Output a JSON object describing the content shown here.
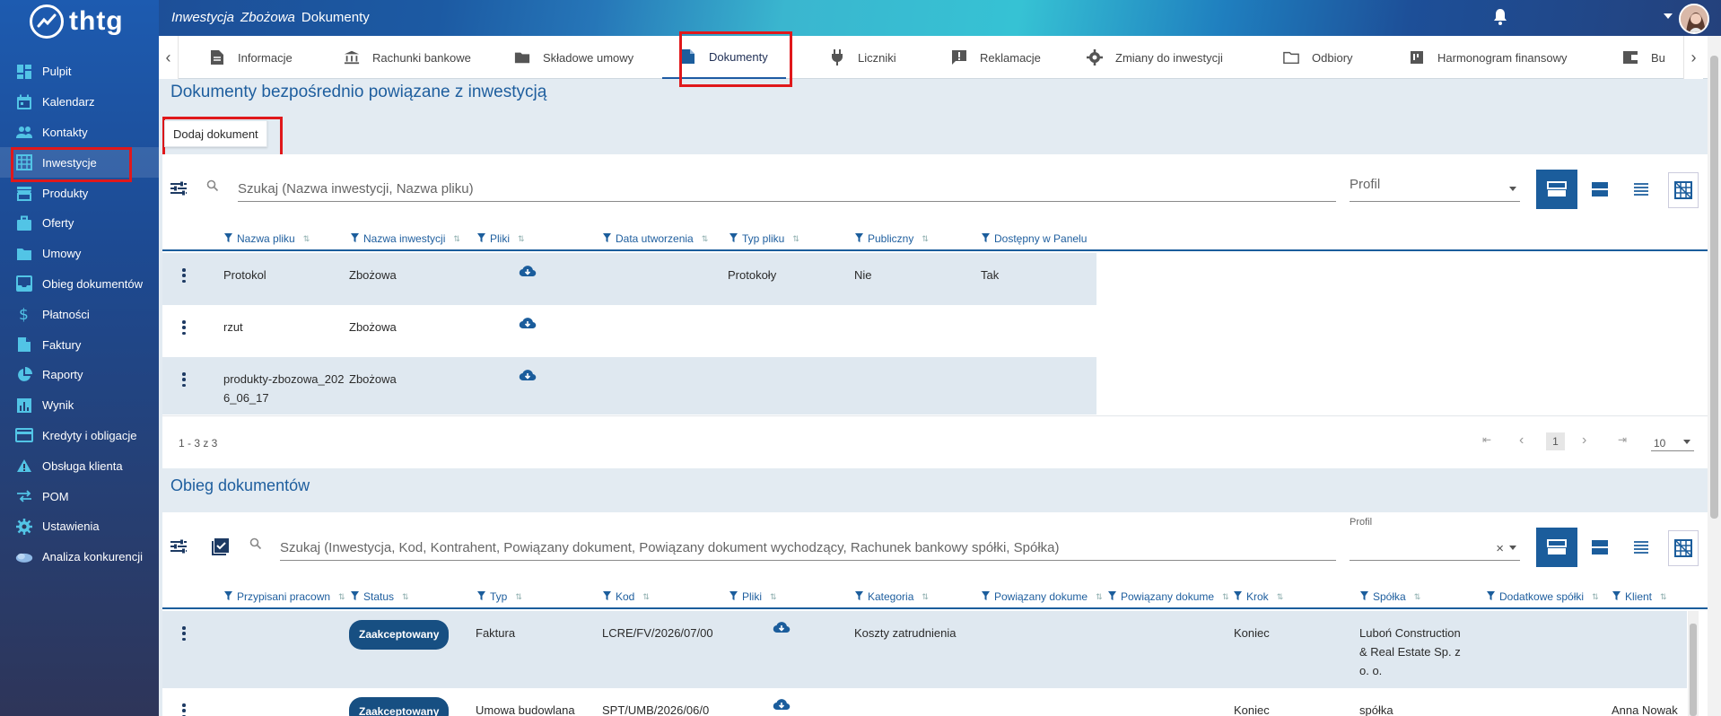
{
  "app": {
    "logo_text": "thtg"
  },
  "breadcrumb": {
    "a": "Inwestycja",
    "b": "Zbożowa",
    "c": "Dokumenty"
  },
  "sidebar": {
    "items": [
      {
        "label": "Pulpit",
        "icon": "dashboard-icon"
      },
      {
        "label": "Kalendarz",
        "icon": "calendar-icon"
      },
      {
        "label": "Kontakty",
        "icon": "people-icon"
      },
      {
        "label": "Inwestycje",
        "icon": "building-icon"
      },
      {
        "label": "Produkty",
        "icon": "store-icon"
      },
      {
        "label": "Oferty",
        "icon": "briefcase-icon"
      },
      {
        "label": "Umowy",
        "icon": "folder-icon"
      },
      {
        "label": "Obieg dokumentów",
        "icon": "inbox-icon"
      },
      {
        "label": "Płatności",
        "icon": "dollar-icon"
      },
      {
        "label": "Faktury",
        "icon": "document-icon"
      },
      {
        "label": "Raporty",
        "icon": "pie-chart-icon"
      },
      {
        "label": "Wynik",
        "icon": "bar-chart-icon"
      },
      {
        "label": "Kredyty i obligacje",
        "icon": "credit-card-icon"
      },
      {
        "label": "Obsługa klienta",
        "icon": "warning-icon"
      },
      {
        "label": "POM",
        "icon": "swap-icon"
      },
      {
        "label": "Ustawienia",
        "icon": "gear-icon"
      },
      {
        "label": "Analiza konkurencji",
        "icon": "cloud-icon"
      }
    ]
  },
  "tabs": [
    {
      "label": "Informacje"
    },
    {
      "label": "Rachunki bankowe"
    },
    {
      "label": "Składowe umowy"
    },
    {
      "label": "Dokumenty"
    },
    {
      "label": "Liczniki"
    },
    {
      "label": "Reklamacje"
    },
    {
      "label": "Zmiany do inwestycji"
    },
    {
      "label": "Odbiory"
    },
    {
      "label": "Harmonogram finansowy"
    },
    {
      "label": "Bu"
    }
  ],
  "docs": {
    "title": "Dokumenty bezpośrednio powiązane z inwestycją",
    "add_label": "Dodaj dokument",
    "search_placeholder": "Szukaj (Nazwa inwestycji, Nazwa pliku)",
    "profile_placeholder": "Profil",
    "columns": [
      "Nazwa pliku",
      "Nazwa inwestycji",
      "Pliki",
      "Data utworzenia",
      "Typ pliku",
      "Publiczny",
      "Dostępny w Panelu"
    ],
    "rows": [
      {
        "name": "Protokol",
        "inv": "Zbożowa",
        "type": "Protokoły",
        "pub": "Nie",
        "panel": "Tak"
      },
      {
        "name": "rzut",
        "inv": "Zbożowa",
        "type": "",
        "pub": "",
        "panel": ""
      },
      {
        "name": "produkty-zbozowa_2026_06_17",
        "inv": "Zbożowa",
        "type": "",
        "pub": "",
        "panel": ""
      }
    ],
    "range": "1 - 3 z 3",
    "page": "1",
    "per_page": "10"
  },
  "flow": {
    "title": "Obieg dokumentów",
    "search_placeholder": "Szukaj (Inwestycja, Kod, Kontrahent, Powiązany dokument, Powiązany dokument wychodzący, Rachunek bankowy spółki, Spółka)",
    "profile_label": "Profil",
    "clear": "×",
    "columns": [
      "Przypisani pracown",
      "Status",
      "Typ",
      "Kod",
      "Pliki",
      "Kategoria",
      "Powiązany dokume",
      "Powiązany dokume",
      "Krok",
      "Spółka",
      "Dodatkowe spółki",
      "Klient"
    ],
    "rows": [
      {
        "status": "Zaakceptowany",
        "typ": "Faktura",
        "kod": "LCRE/FV/2026/07/00",
        "kategoria": "Koszty zatrudnienia",
        "krok": "Koniec",
        "spolka": "Luboń Construction & Real Estate Sp. z o. o.",
        "klient": ""
      },
      {
        "status": "Zaakceptowany",
        "typ": "Umowa budowlana",
        "kod": "SPT/UMB/2026/06/0",
        "kategoria": "",
        "krok": "Koniec",
        "spolka": "spółka",
        "klient": "Anna Nowak"
      }
    ]
  },
  "colors": {
    "accent": "#1b5d9c",
    "highlight": "#e0181b"
  }
}
